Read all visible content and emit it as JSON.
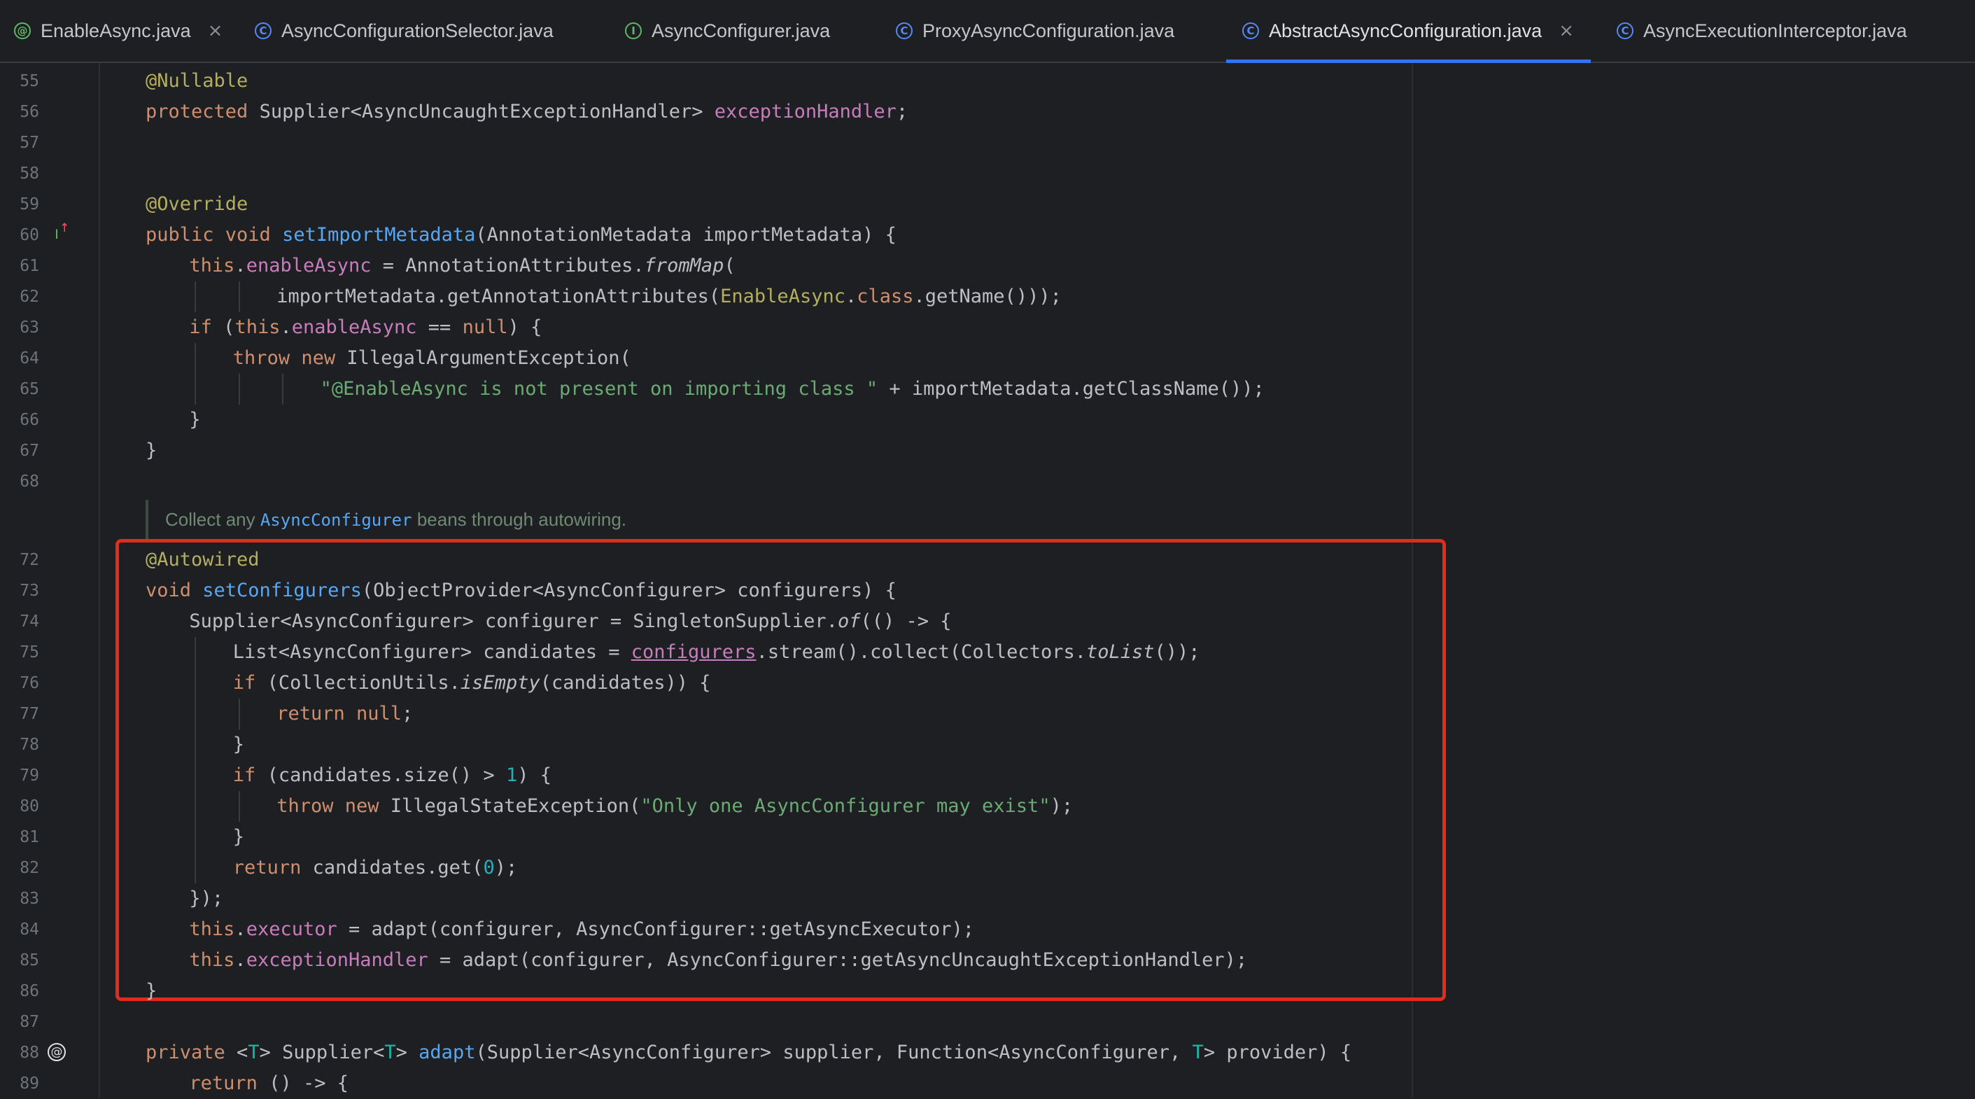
{
  "tabs": [
    {
      "label": "EnableAsync.java",
      "icon": "annotation-type-icon",
      "glyph": "@",
      "closable": true,
      "active": false
    },
    {
      "label": "AsyncConfigurationSelector.java",
      "icon": "class-icon",
      "glyph": "C",
      "closable": false,
      "active": false
    },
    {
      "label": "AsyncConfigurer.java",
      "icon": "interface-icon",
      "glyph": "I",
      "closable": false,
      "active": false
    },
    {
      "label": "ProxyAsyncConfiguration.java",
      "icon": "class-icon",
      "glyph": "C",
      "closable": false,
      "active": false
    },
    {
      "label": "AbstractAsyncConfiguration.java",
      "icon": "class-icon",
      "glyph": "C",
      "closable": true,
      "active": true
    },
    {
      "label": "AsyncExecutionInterceptor.java",
      "icon": "class-icon",
      "glyph": "C",
      "closable": false,
      "active": false
    }
  ],
  "close_glyph": "×",
  "doc_comment": {
    "prefix": "Collect any ",
    "link": "AsyncConfigurer",
    "suffix": " beans through autowiring."
  },
  "gutter_icons": {
    "60": {
      "name": "implements-method-icon",
      "glyph": "I"
    },
    "88": {
      "name": "annotation-marker-icon",
      "glyph": "@"
    }
  },
  "code_lines": [
    {
      "n": "55",
      "indent": 0,
      "segs": [
        [
          "an",
          "@Nullable"
        ]
      ]
    },
    {
      "n": "56",
      "indent": 0,
      "segs": [
        [
          "kw",
          "protected "
        ],
        [
          "",
          "Supplier<AsyncUncaughtExceptionHandler> "
        ],
        [
          "fld",
          "exceptionHandler"
        ],
        [
          "",
          ";"
        ]
      ]
    },
    {
      "n": "57",
      "indent": 0,
      "segs": []
    },
    {
      "n": "58",
      "indent": 0,
      "segs": []
    },
    {
      "n": "59",
      "indent": 0,
      "segs": [
        [
          "an",
          "@Override"
        ]
      ]
    },
    {
      "n": "60",
      "indent": 0,
      "segs": [
        [
          "kw",
          "public void "
        ],
        [
          "fn",
          "setImportMetadata"
        ],
        [
          "",
          "(AnnotationMetadata importMetadata) {"
        ]
      ]
    },
    {
      "n": "61",
      "indent": 1,
      "segs": [
        [
          "kw",
          "this"
        ],
        [
          "",
          "."
        ],
        [
          "fld",
          "enableAsync"
        ],
        [
          "",
          " = AnnotationAttributes."
        ],
        [
          "it",
          "fromMap"
        ],
        [
          "",
          "("
        ]
      ]
    },
    {
      "n": "62",
      "indent": 3,
      "segs": [
        [
          "",
          "importMetadata.getAnnotationAttributes("
        ],
        [
          "an",
          "EnableAsync"
        ],
        [
          "",
          "."
        ],
        [
          "kw",
          "class"
        ],
        [
          "",
          ".getName()));"
        ]
      ]
    },
    {
      "n": "63",
      "indent": 1,
      "segs": [
        [
          "kw",
          "if "
        ],
        [
          "",
          "("
        ],
        [
          "kw",
          "this"
        ],
        [
          "",
          "."
        ],
        [
          "fld",
          "enableAsync"
        ],
        [
          "",
          " == "
        ],
        [
          "kw",
          "null"
        ],
        [
          "",
          ") {"
        ]
      ]
    },
    {
      "n": "64",
      "indent": 2,
      "segs": [
        [
          "kw",
          "throw new "
        ],
        [
          "",
          "IllegalArgumentException("
        ]
      ]
    },
    {
      "n": "65",
      "indent": 4,
      "segs": [
        [
          "str",
          "\"@EnableAsync is not present on importing class \""
        ],
        [
          "",
          " + importMetadata.getClassName());"
        ]
      ]
    },
    {
      "n": "66",
      "indent": 1,
      "segs": [
        [
          "",
          "}"
        ]
      ]
    },
    {
      "n": "67",
      "indent": 0,
      "segs": [
        [
          "",
          "}"
        ]
      ]
    },
    {
      "n": "68",
      "indent": 0,
      "segs": []
    },
    {
      "n": "72",
      "indent": 0,
      "segs": [
        [
          "an",
          "@Autowired"
        ]
      ]
    },
    {
      "n": "73",
      "indent": 0,
      "segs": [
        [
          "kw",
          "void "
        ],
        [
          "fn",
          "setConfigurers"
        ],
        [
          "",
          "(ObjectProvider<AsyncConfigurer> configurers) {"
        ]
      ]
    },
    {
      "n": "74",
      "indent": 1,
      "segs": [
        [
          "",
          "Supplier<AsyncConfigurer> configurer = SingletonSupplier."
        ],
        [
          "it",
          "of"
        ],
        [
          "",
          "(() -> {"
        ]
      ]
    },
    {
      "n": "75",
      "indent": 2,
      "segs": [
        [
          "",
          "List<AsyncConfigurer> candidates = "
        ],
        [
          "ul",
          "configurers"
        ],
        [
          "",
          ".stream().collect(Collectors."
        ],
        [
          "it",
          "toList"
        ],
        [
          "",
          "());"
        ]
      ]
    },
    {
      "n": "76",
      "indent": 2,
      "segs": [
        [
          "kw",
          "if "
        ],
        [
          "",
          "(CollectionUtils."
        ],
        [
          "it",
          "isEmpty"
        ],
        [
          "",
          "(candidates)) {"
        ]
      ]
    },
    {
      "n": "77",
      "indent": 3,
      "segs": [
        [
          "kw",
          "return null"
        ],
        [
          "",
          ";"
        ]
      ]
    },
    {
      "n": "78",
      "indent": 2,
      "segs": [
        [
          "",
          "}"
        ]
      ]
    },
    {
      "n": "79",
      "indent": 2,
      "segs": [
        [
          "kw",
          "if "
        ],
        [
          "",
          "(candidates.size() > "
        ],
        [
          "num",
          "1"
        ],
        [
          "",
          ") {"
        ]
      ]
    },
    {
      "n": "80",
      "indent": 3,
      "segs": [
        [
          "kw",
          "throw new "
        ],
        [
          "",
          "IllegalStateException("
        ],
        [
          "str",
          "\"Only one AsyncConfigurer may exist\""
        ],
        [
          "",
          ");"
        ]
      ]
    },
    {
      "n": "81",
      "indent": 2,
      "segs": [
        [
          "",
          "}"
        ]
      ]
    },
    {
      "n": "82",
      "indent": 2,
      "segs": [
        [
          "kw",
          "return "
        ],
        [
          "",
          "candidates.get("
        ],
        [
          "num",
          "0"
        ],
        [
          "",
          ");"
        ]
      ]
    },
    {
      "n": "83",
      "indent": 1,
      "segs": [
        [
          "",
          "});"
        ]
      ]
    },
    {
      "n": "84",
      "indent": 1,
      "segs": [
        [
          "kw",
          "this"
        ],
        [
          "",
          "."
        ],
        [
          "fld",
          "executor"
        ],
        [
          "",
          " = adapt(configurer, AsyncConfigurer::getAsyncExecutor);"
        ]
      ]
    },
    {
      "n": "85",
      "indent": 1,
      "segs": [
        [
          "kw",
          "this"
        ],
        [
          "",
          "."
        ],
        [
          "fld",
          "exceptionHandler"
        ],
        [
          "",
          " = adapt(configurer, AsyncConfigurer::getAsyncUncaughtExceptionHandler);"
        ]
      ]
    },
    {
      "n": "86",
      "indent": 0,
      "segs": [
        [
          "",
          "}"
        ]
      ]
    },
    {
      "n": "87",
      "indent": 0,
      "segs": []
    },
    {
      "n": "88",
      "indent": 0,
      "segs": [
        [
          "kw",
          "private "
        ],
        [
          "",
          "<"
        ],
        [
          "tp",
          "T"
        ],
        [
          "",
          "> Supplier<"
        ],
        [
          "tp",
          "T"
        ],
        [
          "",
          "> "
        ],
        [
          "fn",
          "adapt"
        ],
        [
          "",
          "(Supplier<AsyncConfigurer> supplier, Function<AsyncConfigurer, "
        ],
        [
          "tp",
          "T"
        ],
        [
          "",
          "> provider) {"
        ]
      ]
    },
    {
      "n": "89",
      "indent": 1,
      "segs": [
        [
          "kw",
          "return "
        ],
        [
          "",
          "() -> {"
        ]
      ]
    }
  ],
  "colors": {
    "background": "#1e1f22",
    "keyword": "#cf8e6d",
    "annotation": "#b3ae60",
    "method": "#56a8f5",
    "field": "#c77dbb",
    "string": "#6aab73",
    "number": "#2aacb8",
    "highlight_box": "#e32b1b",
    "active_tab_underline": "#3574f0"
  }
}
